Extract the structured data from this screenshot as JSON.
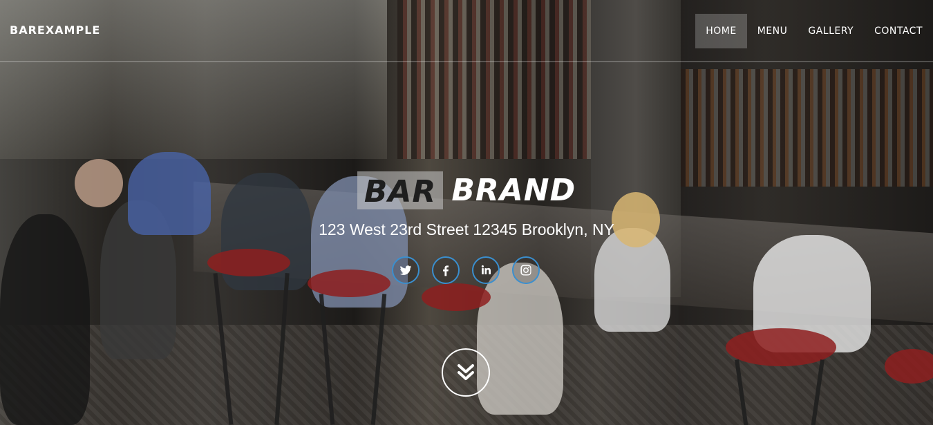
{
  "header": {
    "logo": "BAREXAMPLE",
    "nav": [
      {
        "label": "HOME",
        "active": true
      },
      {
        "label": "MENU",
        "active": false
      },
      {
        "label": "GALLERY",
        "active": false
      },
      {
        "label": "CONTACT",
        "active": false
      }
    ]
  },
  "hero": {
    "title_part1": "BAR",
    "title_part2": "BRAND",
    "address": "123 West 23rd Street 12345 Brooklyn, NY",
    "socials": [
      {
        "icon": "twitter-icon"
      },
      {
        "icon": "facebook-icon"
      },
      {
        "icon": "linkedin-icon"
      },
      {
        "icon": "instagram-icon"
      }
    ],
    "scroll_icon": "double-chevron-down-icon"
  },
  "colors": {
    "accent_ring": "#3a8fcf",
    "active_nav_bg": "rgba(255,255,255,0.22)",
    "title_highlight_bg": "rgba(200,200,200,0.55)"
  }
}
